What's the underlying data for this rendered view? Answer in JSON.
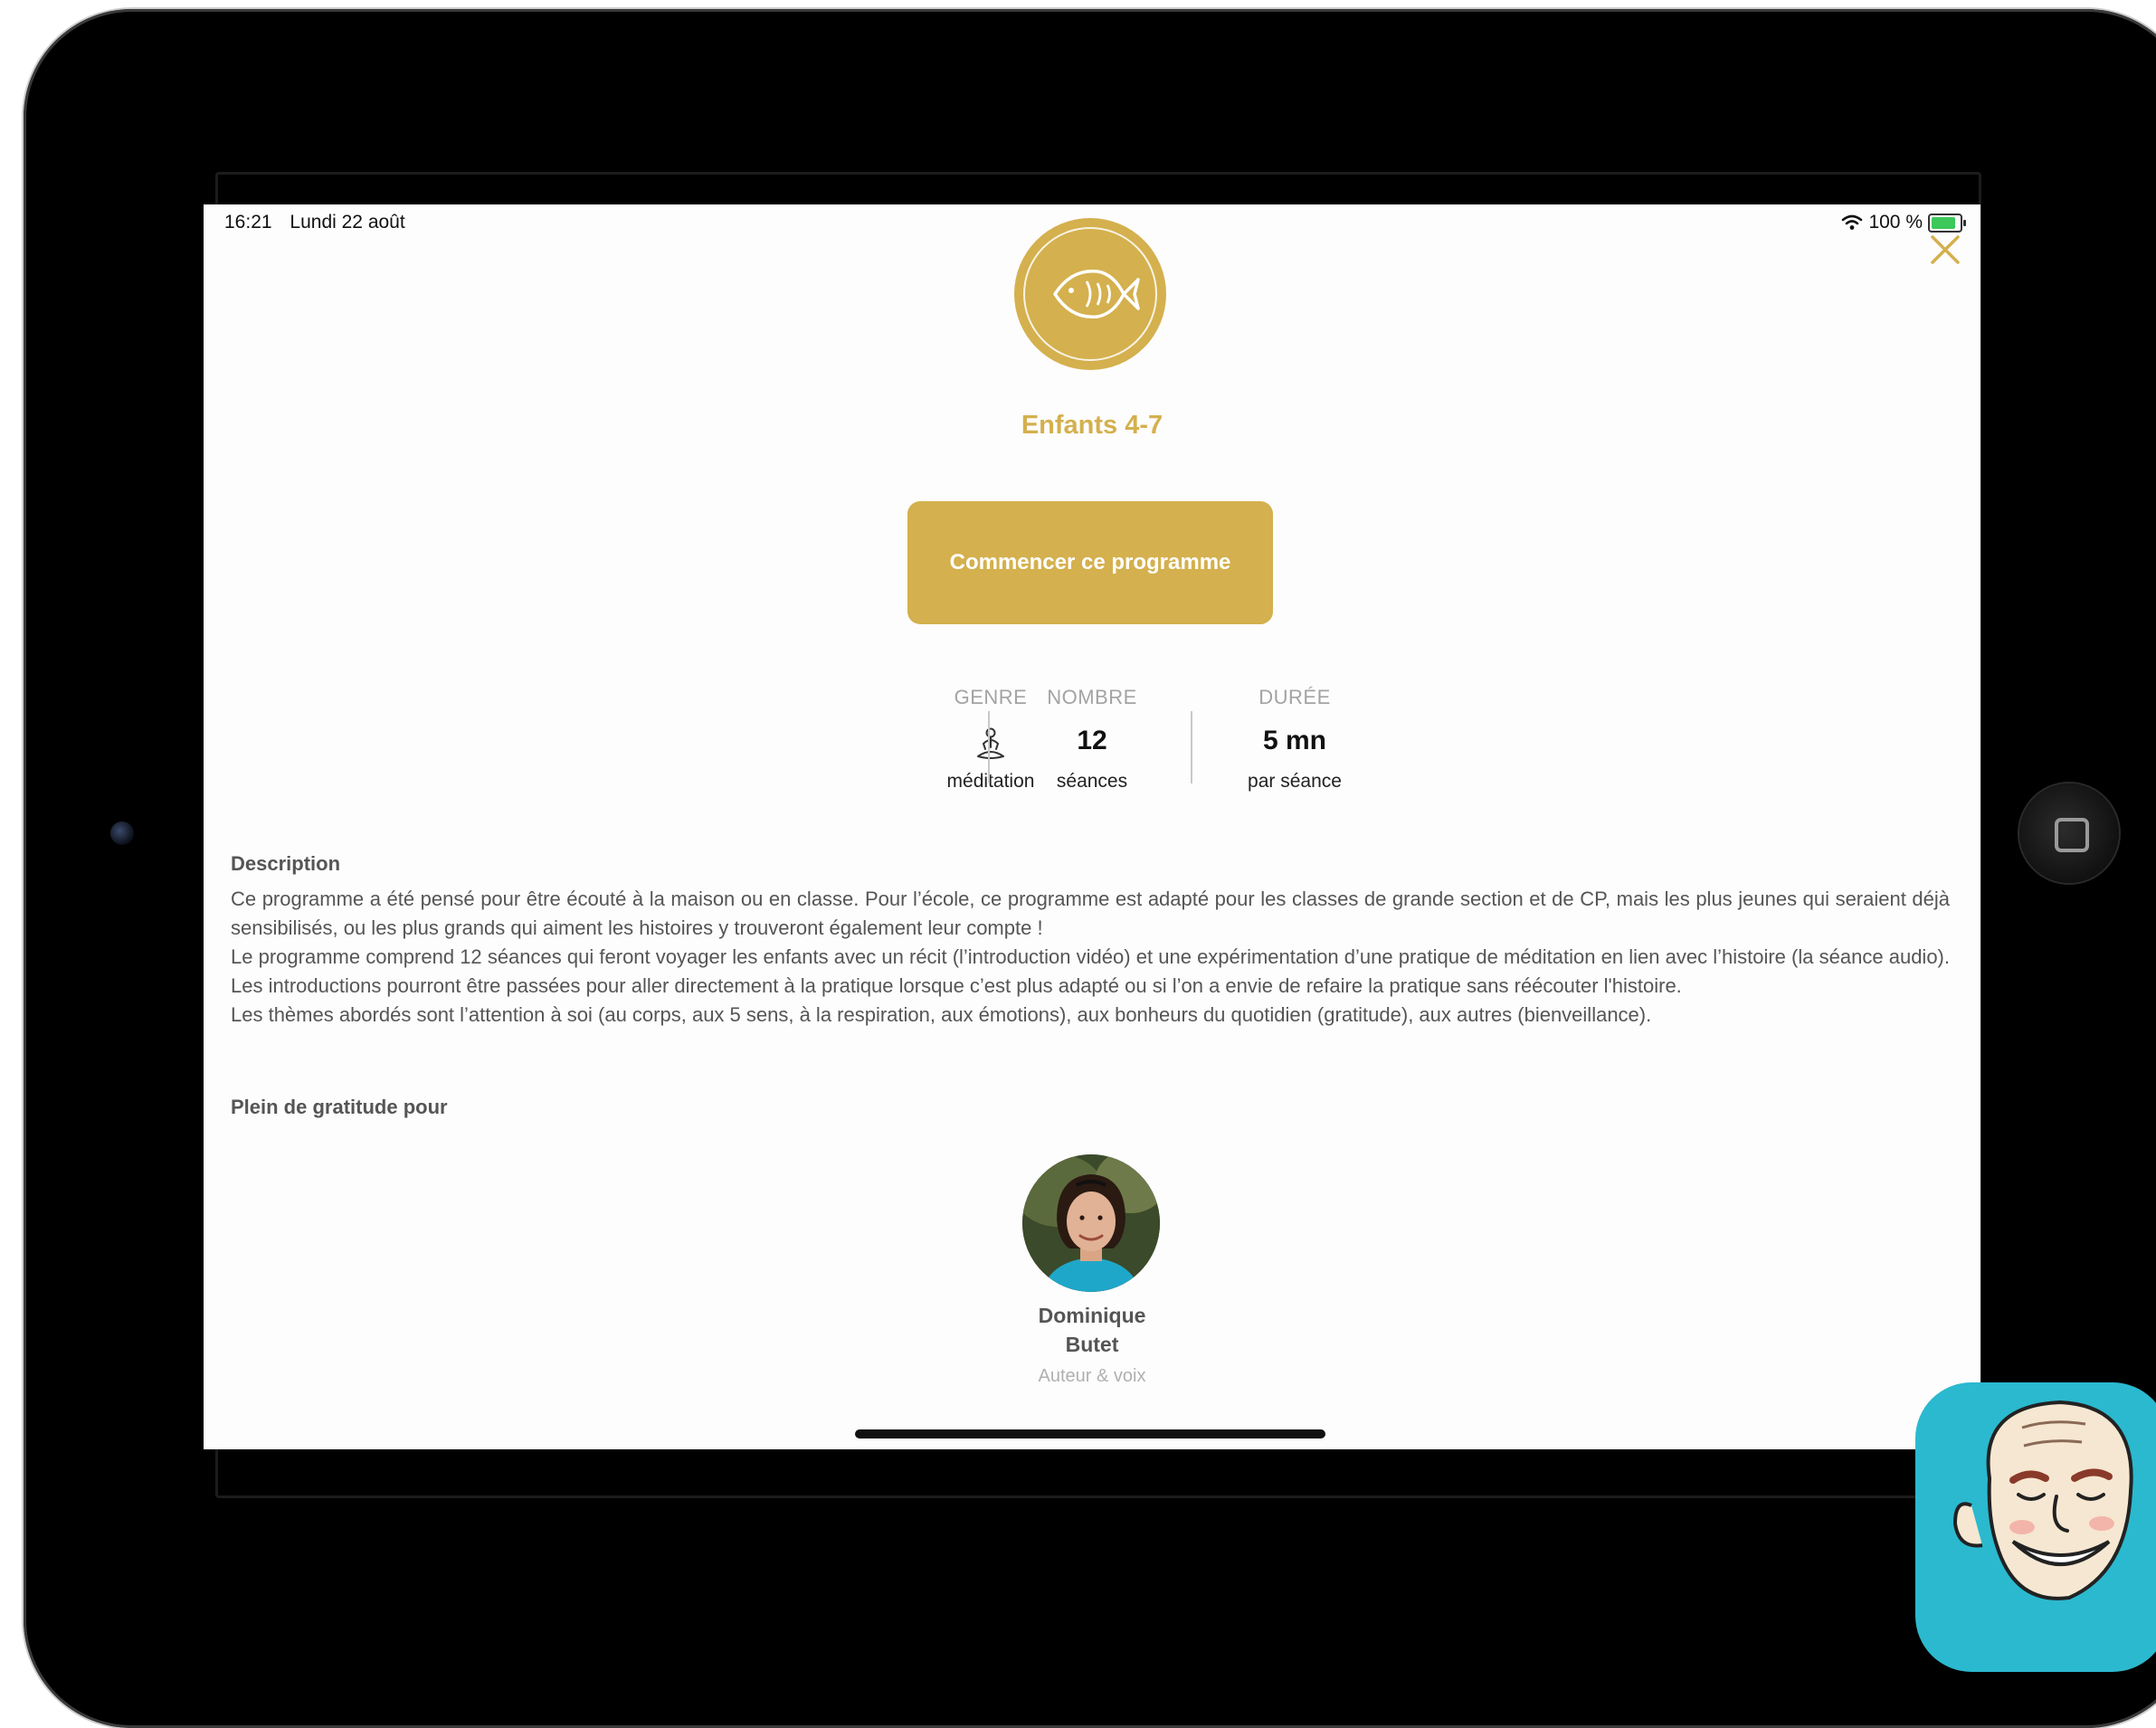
{
  "status_bar": {
    "time": "16:21",
    "date": "Lundi 22 août",
    "battery_text": "100 %",
    "battery_level": 1.0
  },
  "program": {
    "title": "Enfants 4-7",
    "cta_label": "Commencer ce programme"
  },
  "stats": [
    {
      "label": "GENRE",
      "value": "",
      "caption": "méditation"
    },
    {
      "label": "NOMBRE",
      "value": "12",
      "caption": "séances"
    },
    {
      "label": "DURÉE",
      "value": "5 mn",
      "caption": "par séance"
    }
  ],
  "description": {
    "heading": "Description",
    "paragraphs": [
      "Ce programme a été pensé pour être écouté à la maison ou en classe. Pour l’école, ce programme est adapté pour les classes de grande section et de CP, mais les plus jeunes qui seraient déjà sensibilisés, ou les plus grands qui aiment les histoires y trouveront également leur compte !",
      "Le programme comprend 12 séances qui feront voyager les enfants avec un récit (l’introduction vidéo) et une expérimentation d’une pratique de méditation en lien avec l’histoire (la séance audio). Les introductions pourront être passées pour aller directement à la pratique lorsque c’est plus adapté ou si l’on a envie de refaire la pratique sans réécouter l'histoire.",
      "Les thèmes abordés sont l’attention à soi (au corps, aux 5 sens, à la respiration, aux émotions), aux bonheurs du quotidien (gratitude), aux autres (bienveillance)."
    ]
  },
  "gratitude": {
    "heading": "Plein de gratitude pour",
    "author": {
      "first_name": "Dominique",
      "last_name": "Butet",
      "role": "Auteur & voix"
    }
  },
  "colors": {
    "accent": "#d4b04e",
    "app_icon_bg": "#2bb9cf",
    "text_body": "#555555"
  },
  "icons": [
    "fish-icon",
    "close-icon",
    "meditation-icon",
    "wifi-icon",
    "battery-icon"
  ]
}
